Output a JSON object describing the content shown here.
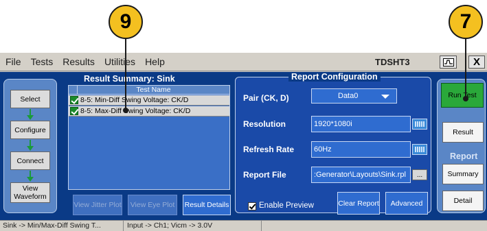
{
  "callouts": {
    "left": "9",
    "right": "7"
  },
  "menu": [
    "File",
    "Tests",
    "Results",
    "Utilities",
    "Help"
  ],
  "app_title": "TDSHT3",
  "window_controls": {
    "close": "X"
  },
  "nav": {
    "items": [
      {
        "label": "Select"
      },
      {
        "label": "Configure"
      },
      {
        "label": "Connect"
      },
      {
        "label": "View Waveform"
      }
    ]
  },
  "result_summary": {
    "title": "Result Summary: Sink",
    "column_header": "Test Name",
    "rows": [
      {
        "name": "8-5: Min-Diff Swing Voltage: CK/D",
        "checked": true
      },
      {
        "name": "8-5: Max-Diff Swing Voltage: CK/D",
        "checked": true
      }
    ],
    "buttons": {
      "jitter": "View Jitter Plot",
      "eye": "View Eye Plot",
      "details": "Result Details"
    }
  },
  "report_config": {
    "title": "Report Configuration",
    "pair_label": "Pair (CK, D)",
    "pair_value": "Data0",
    "resolution_label": "Resolution",
    "resolution_value": "1920*1080i",
    "refresh_label": "Refresh Rate",
    "refresh_value": "60Hz",
    "report_file_label": "Report File",
    "report_file_value": ":Generator\\Layouts\\Sink.rpl",
    "browse_label": "...",
    "enable_preview_label": "Enable Preview",
    "enable_preview_checked": true,
    "clear_report": "Clear Report",
    "advanced": "Advanced"
  },
  "right_panel": {
    "run_test": "Run Test",
    "result": "Result",
    "report_legend": "Report",
    "summary": "Summary",
    "detail": "Detail"
  },
  "status": {
    "left": "Sink -> Min/Max-Diff Swing T...",
    "right": "Input -> Ch1; Vicm -> 3.0V"
  },
  "colors": {
    "panel_bg": "#0a3a86",
    "accent_green": "#2aa83a",
    "callout": "#f4c020"
  }
}
